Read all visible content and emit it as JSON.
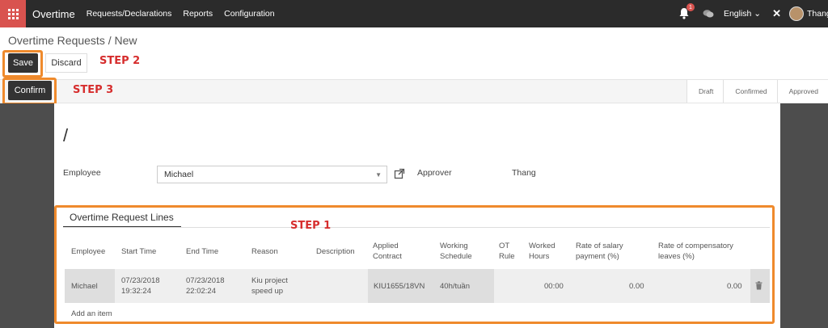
{
  "navbar": {
    "brand": "Overtime",
    "menus": [
      "Requests/Declarations",
      "Reports",
      "Configuration"
    ],
    "notification_count": "1",
    "language": "English ⌄",
    "user": "Thang"
  },
  "breadcrumb": "Overtime Requests /  New",
  "buttons": {
    "save": "Save",
    "discard": "Discard",
    "confirm": "Confirm"
  },
  "steps": {
    "step1": "STEP 1",
    "step2": "STEP 2",
    "step3": "STEP 3"
  },
  "statusbar": [
    "Draft",
    "Confirmed",
    "Approved"
  ],
  "form": {
    "name": "/",
    "employee_label": "Employee",
    "employee_value": "Michael",
    "approver_label": "Approver",
    "approver_value": "Thang"
  },
  "lines": {
    "tab": "Overtime Request Lines",
    "headers": {
      "employee": "Employee",
      "start_time": "Start Time",
      "end_time": "End Time",
      "reason": "Reason",
      "description": "Description",
      "applied_contract_1": "Applied",
      "applied_contract_2": "Contract",
      "working_schedule_1": "Working",
      "working_schedule_2": "Schedule",
      "ot_rule_1": "OT",
      "ot_rule_2": "Rule",
      "worked_hours_1": "Worked",
      "worked_hours_2": "Hours",
      "rate_salary_1": "Rate of salary",
      "rate_salary_2": "payment (%)",
      "rate_comp_1": "Rate of compensatory",
      "rate_comp_2": "leaves (%)"
    },
    "row": {
      "employee": "Michael",
      "start_date": "07/23/2018",
      "start_time": "19:32:24",
      "end_date": "07/23/2018",
      "end_time": "22:02:24",
      "reason_1": "Kiu project",
      "reason_2": "speed up",
      "description": "",
      "contract": "KIU1655/18VN",
      "schedule": "40h/tuần",
      "ot_rule": "",
      "worked_hours": "00:00",
      "rate_salary": "0.00",
      "rate_comp": "0.00"
    },
    "add_item": "Add an item"
  }
}
